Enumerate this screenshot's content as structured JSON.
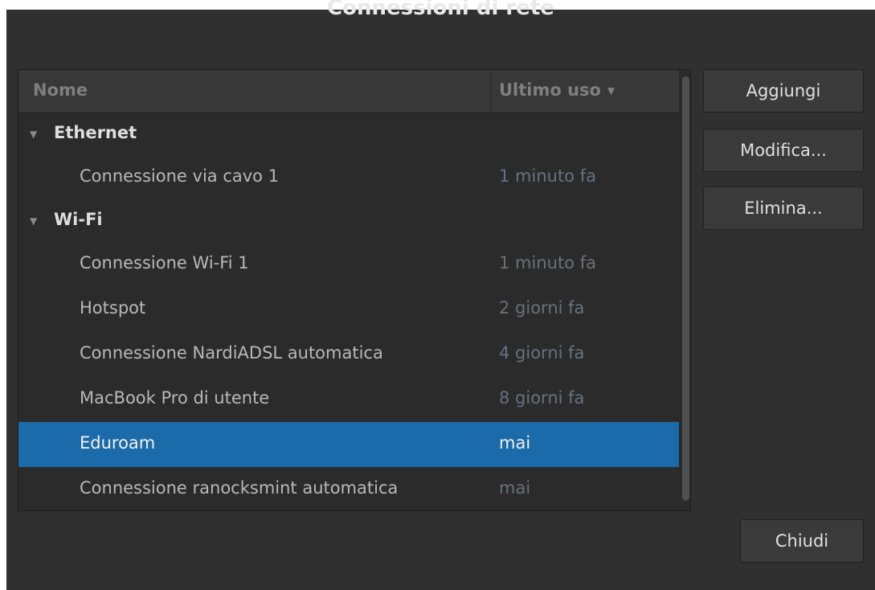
{
  "window": {
    "title": "Connessioni di rete"
  },
  "list": {
    "columns": {
      "name": "Nome",
      "last_used": "Ultimo uso"
    },
    "groups": [
      {
        "label": "Ethernet",
        "connections": [
          {
            "name": "Connessione via cavo 1",
            "last_used": "1 minuto fa"
          }
        ]
      },
      {
        "label": "Wi-Fi",
        "connections": [
          {
            "name": "Connessione Wi-Fi 1",
            "last_used": "1 minuto fa"
          },
          {
            "name": "Hotspot",
            "last_used": "2 giorni fa"
          },
          {
            "name": "Connessione NardiADSL automatica",
            "last_used": "4 giorni fa"
          },
          {
            "name": "MacBook Pro di utente",
            "last_used": "8 giorni fa"
          },
          {
            "name": "Eduroam",
            "last_used": "mai"
          },
          {
            "name": "Connessione ranocksmint automatica",
            "last_used": "mai"
          }
        ]
      }
    ],
    "selected": "Eduroam"
  },
  "buttons": {
    "add": "Aggiungi",
    "edit": "Modifica...",
    "delete": "Elimina...",
    "close": "Chiudi"
  },
  "icons": {
    "expander": "triangle-down-icon",
    "sort": "sort-descending-icon"
  },
  "colors": {
    "background": "#303030",
    "selection": "#1b6aa9",
    "muted_text": "#69717d"
  }
}
